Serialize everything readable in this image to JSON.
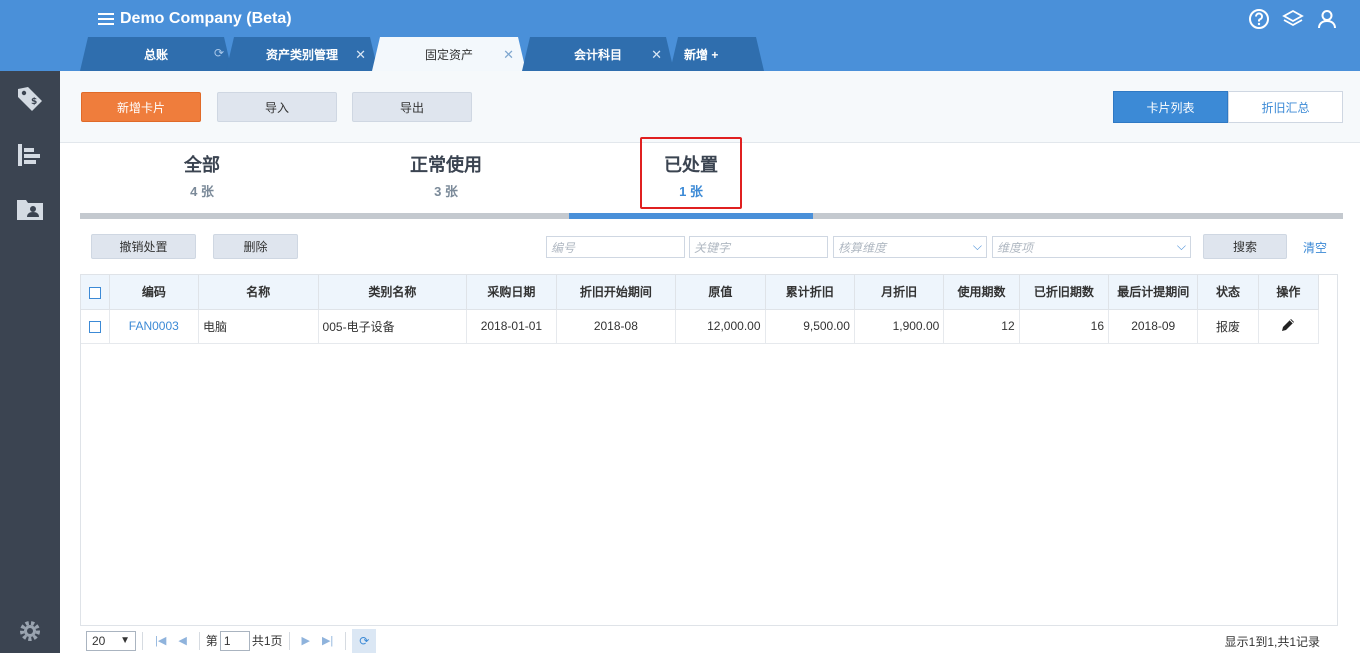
{
  "app": {
    "title": "Demo Company (Beta)"
  },
  "tabs": [
    {
      "label": "总账"
    },
    {
      "label": "资产类别管理"
    },
    {
      "label": "固定资产"
    },
    {
      "label": "会计科目"
    },
    {
      "label": "新增 +"
    }
  ],
  "toolbar": {
    "add_card": "新增卡片",
    "import": "导入",
    "export": "导出",
    "card_list": "卡片列表",
    "depreciation_summary": "折旧汇总"
  },
  "status_tabs": [
    {
      "title": "全部",
      "count": "4 张"
    },
    {
      "title": "正常使用",
      "count": "3 张"
    },
    {
      "title": "已处置",
      "count": "1 张"
    }
  ],
  "actions": {
    "undo_dispose": "撤销处置",
    "delete": "删除",
    "search": "搜索",
    "clear": "清空"
  },
  "filters": {
    "code_placeholder": "编号",
    "keyword_placeholder": "关键字",
    "dimension_placeholder": "核算维度",
    "dimension_item_placeholder": "维度项"
  },
  "table": {
    "headers": [
      "编码",
      "名称",
      "类别名称",
      "采购日期",
      "折旧开始期间",
      "原值",
      "累计折旧",
      "月折旧",
      "使用期数",
      "已折旧期数",
      "最后计提期间",
      "状态",
      "操作"
    ],
    "rows": [
      {
        "code": "FAN0003",
        "name": "电脑",
        "category": "005-电子设备",
        "purchase_date": "2018-01-01",
        "dep_start": "2018-08",
        "original_value": "12,000.00",
        "accum_dep": "9,500.00",
        "monthly_dep": "1,900.00",
        "periods": "12",
        "dep_periods": "16",
        "last_period": "2018-09",
        "status": "报废"
      }
    ]
  },
  "pager": {
    "page_size": "20",
    "page_prefix": "第",
    "page": "1",
    "page_total": "共1页",
    "summary": "显示1到1,共1记录"
  },
  "colors": {
    "header_blue": "#4a90d9",
    "sidebar": "#3b4451",
    "accent_orange": "#ef7d3c",
    "highlight_red": "#e02020"
  }
}
